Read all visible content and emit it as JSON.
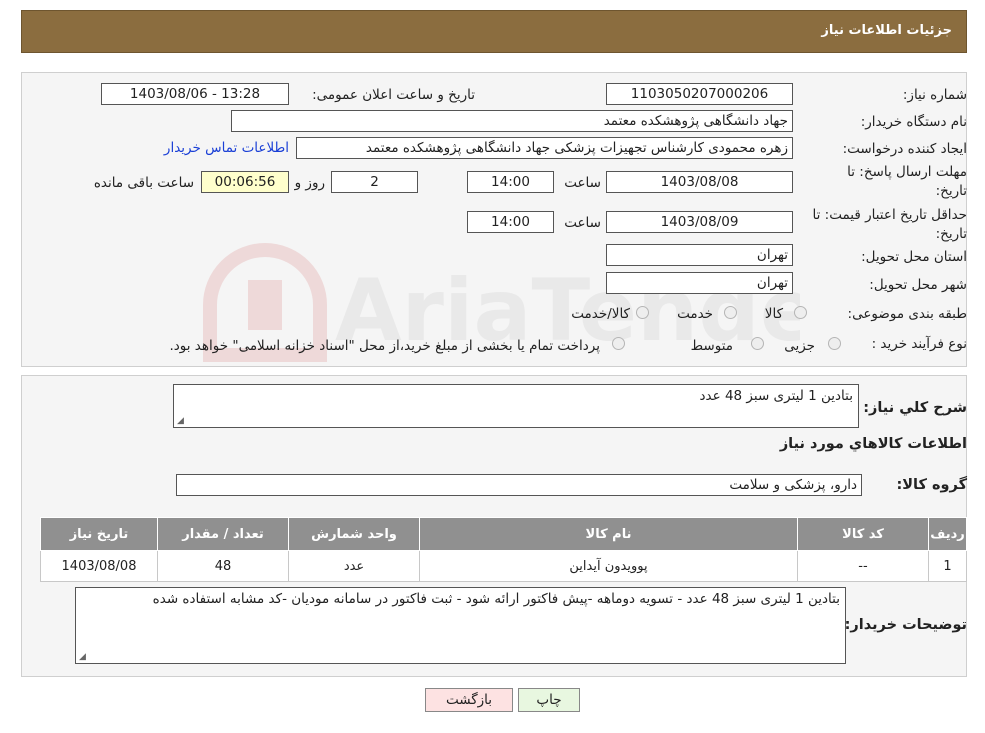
{
  "header": {
    "title": "جزئیات اطلاعات نیاز"
  },
  "fields": {
    "need_number": {
      "label": "شماره نیاز:",
      "value": "1103050207000206"
    },
    "announce_datetime": {
      "label": "تاریخ و ساعت اعلان عمومی:",
      "value": "1403/08/06 - 13:28"
    },
    "buyer_org": {
      "label": "نام دستگاه خریدار:",
      "value": "جهاد دانشگاهی پژوهشکده معتمد"
    },
    "requester": {
      "label": "ایجاد کننده درخواست:",
      "value": "زهره محمودی کارشناس تجهیزات پزشکی جهاد دانشگاهی پژوهشکده معتمد"
    },
    "contact_link": "اطلاعات تماس خریدار",
    "response_deadline": {
      "label": "مهلت ارسال پاسخ: تا تاریخ:",
      "date": "1403/08/08",
      "time_label": "ساعت",
      "time": "14:00",
      "days": "2",
      "days_label": "روز و",
      "remaining": "00:06:56",
      "remaining_label": "ساعت باقی مانده"
    },
    "price_validity": {
      "label": "حداقل تاریخ اعتبار قیمت: تا تاریخ:",
      "date": "1403/08/09",
      "time_label": "ساعت",
      "time": "14:00"
    },
    "province": {
      "label": "استان محل تحویل:",
      "value": "تهران"
    },
    "city": {
      "label": "شهر محل تحویل:",
      "value": "تهران"
    },
    "category": {
      "label": "طبقه بندی موضوعی:",
      "options": [
        "کالا",
        "خدمت",
        "کالا/خدمت"
      ]
    },
    "purchase_process": {
      "label": "نوع فرآیند خرید :",
      "options": [
        "جزیی",
        "متوسط"
      ],
      "note": "پرداخت تمام یا بخشی از مبلغ خرید،از محل \"اسناد خزانه اسلامی\" خواهد بود."
    }
  },
  "watermark": "AriaTender.neT",
  "summary": {
    "label": "شرح کلي نياز:",
    "value": "بتادین 1 لیتری سبز 48 عدد"
  },
  "items_section": {
    "title": "اطلاعات کالاهاي مورد نياز",
    "group_label": "گروه کالا:",
    "group_value": "دارو، پزشکی و سلامت",
    "columns": [
      "ردیف",
      "کد کالا",
      "نام کالا",
      "واحد شمارش",
      "تعداد / مقدار",
      "تاریخ نیاز"
    ],
    "rows": [
      [
        "1",
        "--",
        "پوویدون آیداین",
        "عدد",
        "48",
        "1403/08/08"
      ]
    ]
  },
  "buyer_notes": {
    "label": "توضیحات خریدار:",
    "value": "بتادین 1 لیتری سبز 48 عدد - تسویه دوماهه -پیش فاکتور ارائه شود - ثبت فاکتور در سامانه مودیان -کد مشابه استفاده شده"
  },
  "buttons": {
    "print": "چاپ",
    "back": "بازگشت"
  },
  "colors": {
    "header_bg": "#8b6d3f",
    "table_header_bg": "#909090",
    "link": "#1a3fd6",
    "back_button_bg": "#fde2e2",
    "print_button_bg": "#e8f7e0"
  }
}
